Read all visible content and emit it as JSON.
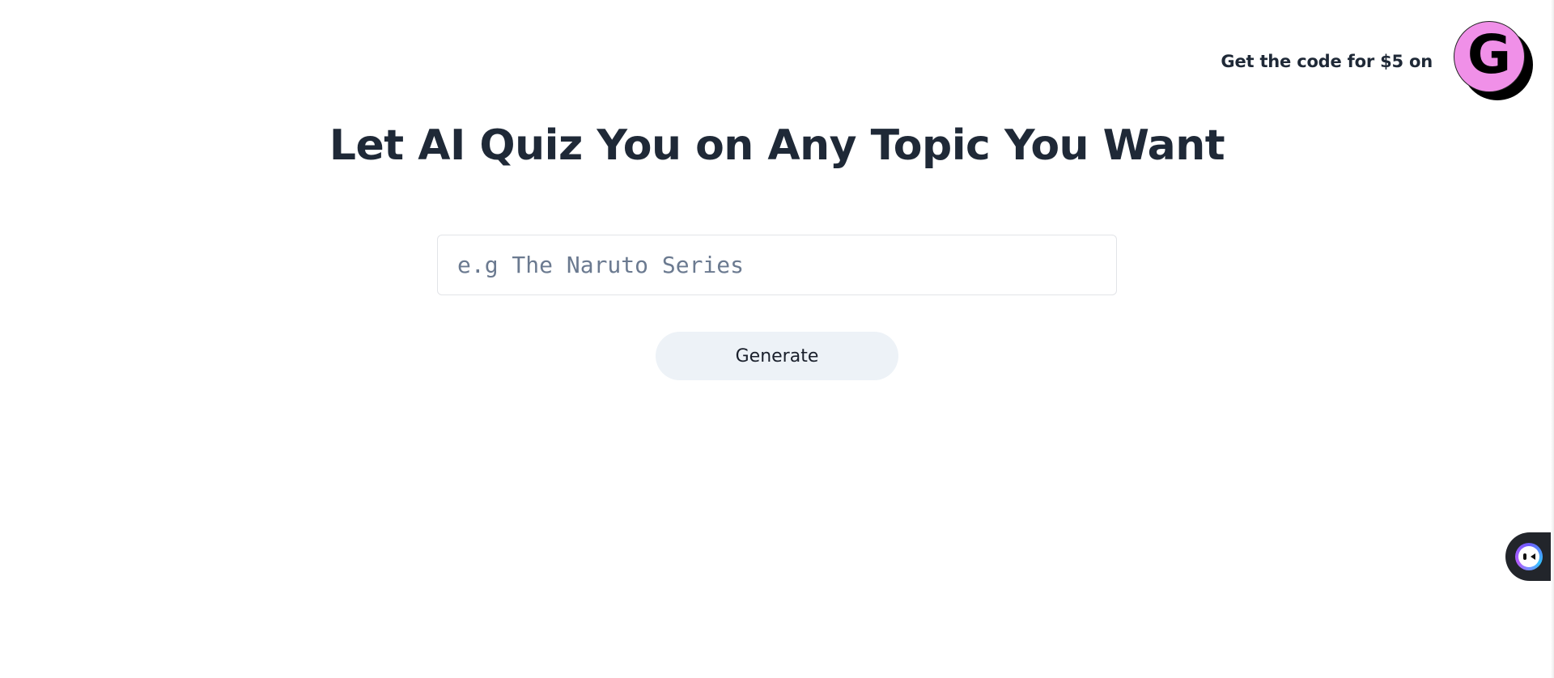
{
  "promo": {
    "text": "Get the code for $5 on",
    "logo_letter": "G",
    "logo_color": "#f090e8",
    "logo_icon": "gumroad-logo-icon"
  },
  "main": {
    "heading": "Let AI Quiz You on Any Topic You Want",
    "topic_input": {
      "value": "",
      "placeholder": "e.g The Naruto Series"
    },
    "generate_label": "Generate"
  },
  "widget": {
    "icon": "assistant-face-icon"
  },
  "colors": {
    "heading": "#1f2937",
    "button_bg": "#edf2f7",
    "input_border": "#e2e4e8",
    "placeholder": "#6b7a90"
  }
}
